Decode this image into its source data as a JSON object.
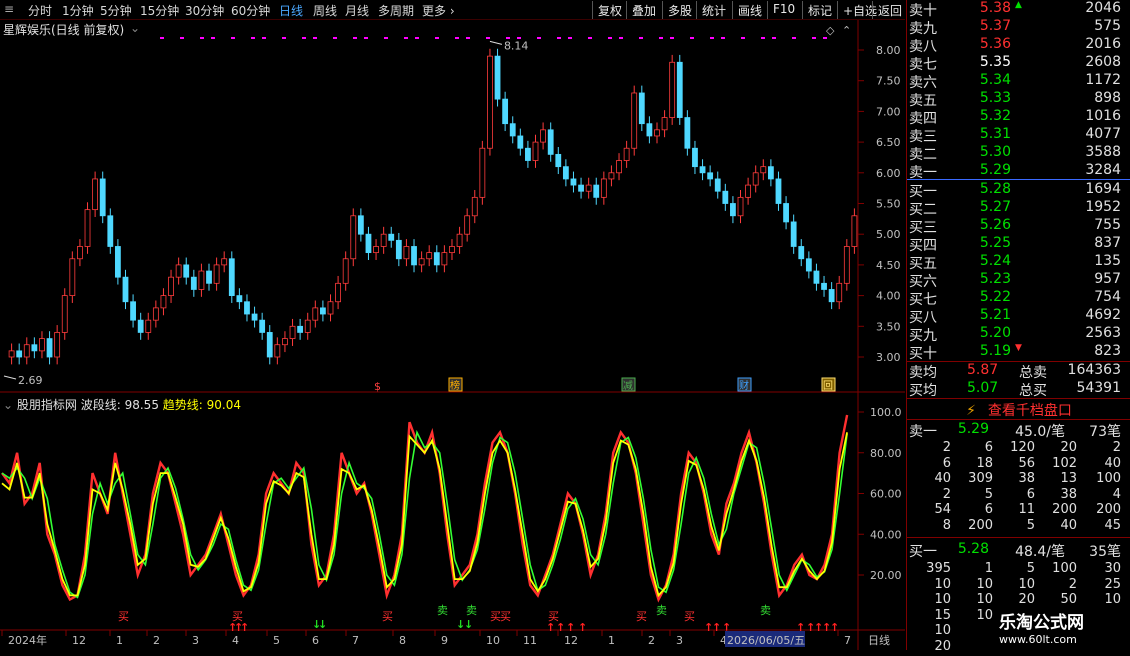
{
  "toolbar": {
    "periods": [
      "分时",
      "1分钟",
      "5分钟",
      "15分钟",
      "30分钟",
      "60分钟",
      "日线",
      "周线",
      "月线",
      "多周期",
      "更多"
    ],
    "active_period": "日线",
    "buttons": [
      "复权",
      "叠加",
      "多股",
      "统计",
      "画线",
      "F10",
      "标记",
      "+自选",
      "返回"
    ]
  },
  "main_chart": {
    "title": "星辉娱乐(日线 前复权)",
    "high_label": "8.14",
    "low_label": "2.69",
    "y_ticks": [
      "8.00",
      "7.50",
      "7.00",
      "6.50",
      "6.00",
      "5.50",
      "5.00",
      "4.50",
      "4.00",
      "3.50",
      "3.00"
    ],
    "event_markers": [
      "$",
      "榜",
      "减",
      "财",
      "回"
    ]
  },
  "indicator": {
    "name": "股朋指标网",
    "wave_label": "波段线:",
    "wave_value": "98.55",
    "trend_label": "趋势线:",
    "trend_value": "90.04",
    "y_ticks": [
      "100.0",
      "80.00",
      "60.00",
      "40.00",
      "20.00"
    ],
    "buy_text": "买",
    "sell_text": "卖"
  },
  "time_axis": {
    "labels": [
      "2024年",
      "12",
      "1",
      "2",
      "3",
      "4",
      "5",
      "6",
      "7",
      "8",
      "9",
      "10",
      "11",
      "12",
      "1",
      "2",
      "3",
      "4",
      "2026/06/05/五",
      "7"
    ],
    "period_label": "日线"
  },
  "orderbook": {
    "asks": [
      {
        "label": "卖十",
        "price": "5.38",
        "vol": "2046",
        "up": true
      },
      {
        "label": "卖九",
        "price": "5.37",
        "vol": "575"
      },
      {
        "label": "卖八",
        "price": "5.36",
        "vol": "2016"
      },
      {
        "label": "卖七",
        "price": "5.35",
        "vol": "2608"
      },
      {
        "label": "卖六",
        "price": "5.34",
        "vol": "1172"
      },
      {
        "label": "卖五",
        "price": "5.33",
        "vol": "898"
      },
      {
        "label": "卖四",
        "price": "5.32",
        "vol": "1016"
      },
      {
        "label": "卖三",
        "price": "5.31",
        "vol": "4077"
      },
      {
        "label": "卖二",
        "price": "5.30",
        "vol": "3588"
      },
      {
        "label": "卖一",
        "price": "5.29",
        "vol": "3284"
      }
    ],
    "bids": [
      {
        "label": "买一",
        "price": "5.28",
        "vol": "1694"
      },
      {
        "label": "买二",
        "price": "5.27",
        "vol": "1952"
      },
      {
        "label": "买三",
        "price": "5.26",
        "vol": "755"
      },
      {
        "label": "买四",
        "price": "5.25",
        "vol": "837"
      },
      {
        "label": "买五",
        "price": "5.24",
        "vol": "135"
      },
      {
        "label": "买六",
        "price": "5.23",
        "vol": "957"
      },
      {
        "label": "买七",
        "price": "5.22",
        "vol": "754"
      },
      {
        "label": "买八",
        "price": "5.21",
        "vol": "4692"
      },
      {
        "label": "买九",
        "price": "5.20",
        "vol": "2563"
      },
      {
        "label": "买十",
        "price": "5.19",
        "vol": "823",
        "down": true
      }
    ],
    "avg_sell_label": "卖均",
    "avg_sell": "5.87",
    "total_sell_label": "总卖",
    "total_sell": "164363",
    "avg_buy_label": "买均",
    "avg_buy": "5.07",
    "total_buy_label": "总买",
    "total_buy": "54391",
    "view_button": "查看千档盘口",
    "sell1": {
      "label": "卖一",
      "price": "5.29",
      "per": "45.0/笔",
      "count": "73笔"
    },
    "sell_details": [
      [
        "2",
        "6",
        "120",
        "20",
        "2"
      ],
      [
        "6",
        "18",
        "56",
        "102",
        "40"
      ],
      [
        "40",
        "309",
        "38",
        "13",
        "100"
      ],
      [
        "2",
        "5",
        "6",
        "38",
        "4"
      ],
      [
        "54",
        "6",
        "11",
        "200",
        "200"
      ],
      [
        "8",
        "200",
        "5",
        "40",
        "45"
      ]
    ],
    "buy1": {
      "label": "买一",
      "price": "5.28",
      "per": "48.4/笔",
      "count": "35笔"
    },
    "buy_details": [
      [
        "395",
        "1",
        "5",
        "100",
        "30"
      ],
      [
        "10",
        "10",
        "10",
        "2",
        "25"
      ],
      [
        "10",
        "10",
        "20",
        "50",
        "10"
      ],
      [
        "15",
        "10",
        "",
        "",
        ""
      ],
      [
        "10",
        "",
        "",
        "",
        ""
      ],
      [
        "20",
        "",
        "",
        "",
        ""
      ]
    ]
  },
  "watermark": {
    "line1": "乐淘公式网",
    "line2": "www.60lt.com"
  },
  "chart_data": {
    "type": "candlestick",
    "price_ylim": [
      2.69,
      8.14
    ],
    "close_path": [
      3.0,
      3.1,
      3.0,
      3.2,
      3.1,
      3.3,
      3.0,
      3.4,
      4.0,
      4.6,
      4.8,
      5.4,
      5.9,
      5.3,
      4.8,
      4.3,
      3.9,
      3.6,
      3.4,
      3.6,
      3.8,
      4.0,
      4.3,
      4.5,
      4.3,
      4.1,
      4.4,
      4.2,
      4.5,
      4.6,
      4.0,
      3.9,
      3.7,
      3.6,
      3.4,
      3.0,
      3.2,
      3.3,
      3.5,
      3.4,
      3.6,
      3.8,
      3.7,
      3.9,
      4.2,
      4.6,
      5.3,
      5.0,
      4.7,
      4.8,
      5.0,
      4.9,
      4.6,
      4.8,
      4.5,
      4.6,
      4.7,
      4.5,
      4.7,
      4.8,
      5.0,
      5.3,
      5.6,
      6.4,
      7.9,
      7.2,
      6.8,
      6.6,
      6.4,
      6.2,
      6.5,
      6.7,
      6.3,
      6.1,
      5.9,
      5.8,
      5.7,
      5.8,
      5.6,
      5.9,
      6.0,
      6.2,
      6.4,
      7.3,
      6.8,
      6.6,
      6.7,
      6.9,
      7.8,
      6.9,
      6.4,
      6.1,
      6.0,
      5.9,
      5.7,
      5.5,
      5.3,
      5.6,
      5.8,
      6.0,
      6.1,
      5.9,
      5.5,
      5.2,
      4.8,
      4.6,
      4.4,
      4.2,
      4.1,
      3.9,
      4.2,
      4.8,
      5.3
    ],
    "indicator_ylim": [
      0,
      100
    ],
    "wave": [
      70,
      65,
      80,
      55,
      60,
      75,
      40,
      30,
      15,
      8,
      10,
      30,
      70,
      60,
      50,
      80,
      60,
      40,
      20,
      30,
      60,
      75,
      70,
      55,
      40,
      20,
      25,
      30,
      40,
      50,
      35,
      20,
      10,
      15,
      30,
      60,
      70,
      65,
      60,
      75,
      70,
      35,
      15,
      20,
      40,
      80,
      70,
      60,
      65,
      50,
      30,
      10,
      20,
      40,
      95,
      85,
      80,
      90,
      70,
      40,
      15,
      20,
      25,
      40,
      65,
      85,
      90,
      80,
      60,
      35,
      15,
      10,
      20,
      30,
      45,
      60,
      55,
      40,
      20,
      30,
      50,
      80,
      90,
      85,
      70,
      45,
      20,
      8,
      15,
      30,
      60,
      80,
      75,
      60,
      40,
      30,
      55,
      65,
      80,
      90,
      75,
      55,
      30,
      10,
      15,
      25,
      30,
      20,
      18,
      25,
      40,
      80,
      98.55
    ],
    "trend": [
      65,
      62,
      75,
      58,
      58,
      70,
      45,
      32,
      18,
      10,
      10,
      25,
      62,
      60,
      52,
      75,
      62,
      45,
      25,
      28,
      55,
      70,
      70,
      58,
      45,
      25,
      24,
      28,
      38,
      48,
      38,
      24,
      12,
      14,
      26,
      55,
      66,
      64,
      60,
      70,
      68,
      40,
      18,
      18,
      35,
      72,
      70,
      62,
      64,
      52,
      34,
      14,
      18,
      35,
      88,
      84,
      80,
      86,
      72,
      45,
      18,
      18,
      22,
      36,
      60,
      80,
      86,
      80,
      62,
      40,
      18,
      12,
      18,
      28,
      42,
      56,
      55,
      42,
      24,
      28,
      46,
      75,
      86,
      84,
      72,
      50,
      24,
      10,
      14,
      26,
      55,
      76,
      74,
      62,
      44,
      32,
      50,
      62,
      76,
      86,
      76,
      58,
      34,
      14,
      14,
      22,
      28,
      22,
      18,
      22,
      36,
      72,
      90.04
    ]
  }
}
